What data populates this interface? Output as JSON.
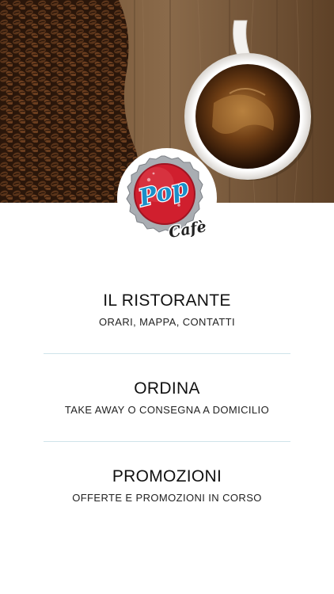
{
  "hero": {
    "image": "coffee-beans-and-espresso-cup"
  },
  "logo": {
    "brand": "Pop",
    "tagline": "Cafè"
  },
  "menu": {
    "items": [
      {
        "title": "IL RISTORANTE",
        "subtitle": "ORARI, MAPPA, CONTATTI"
      },
      {
        "title": "ORDINA",
        "subtitle": "TAKE AWAY O CONSEGNA A DOMICILIO"
      },
      {
        "title": "PROMOZIONI",
        "subtitle": "OFFERTE E PROMOZIONI IN CORSO"
      }
    ]
  },
  "colors": {
    "background": "#ffffff",
    "divider": "#cfe3ea",
    "text": "#111111",
    "cap_red": "#d01f2e",
    "brand_blue": "#1a8fc9"
  }
}
